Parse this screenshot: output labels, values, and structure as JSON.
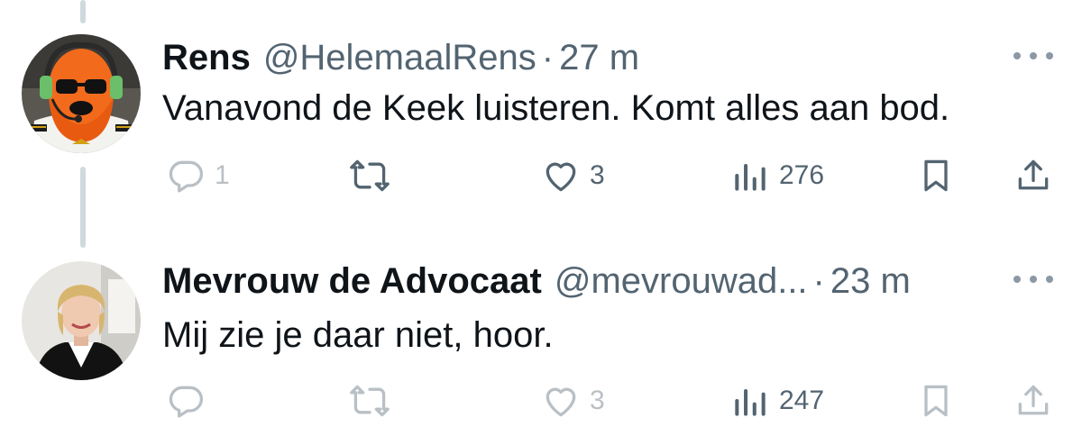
{
  "tweets": [
    {
      "name": "Rens",
      "handle": "@HelemaalRens",
      "separator": "·",
      "time": "27 m",
      "text": "Vanavond de Keek luisteren. Komt alles aan bod.",
      "replies": "1",
      "retweets": "",
      "likes": "3",
      "views": "276",
      "avatar_icon": "orange-mascot-pilot-avatar"
    },
    {
      "name": "Mevrouw de Advocaat",
      "handle": "@mevrouwad...",
      "separator": "·",
      "time": "23 m",
      "text": "Mij zie je daar niet, hoor.",
      "replies": "",
      "retweets": "",
      "likes": "3",
      "views": "247",
      "avatar_icon": "woman-lawyer-avatar"
    }
  ],
  "colors": {
    "text": "#0f1419",
    "muted": "#536471",
    "thread_line": "#cfd9de",
    "icon": "#536471"
  }
}
